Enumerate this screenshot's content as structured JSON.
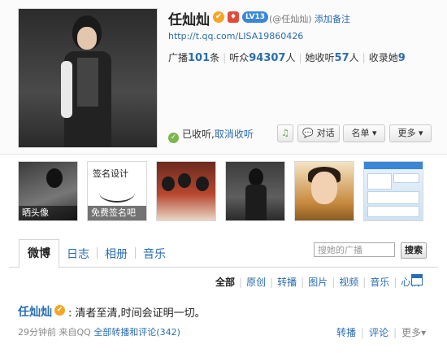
{
  "profile": {
    "name": "任灿灿",
    "v_badge": "✔",
    "r_badge": "♦",
    "level_badge": "LV13",
    "handle": "(@任灿灿)",
    "add_note": "添加备注",
    "url": "http://t.qq.com/LISA19860426",
    "stats": {
      "broadcast_label": "广播",
      "broadcast_value": "101",
      "broadcast_unit": "条",
      "listeners_label": "听众",
      "listeners_value": "94307",
      "listeners_unit": "人",
      "following_label": "她收听",
      "following_value": "57",
      "following_unit": "人",
      "collected_label": "收录她",
      "collected_value": "9"
    },
    "followed_label": "已收听,",
    "unfollow_label": "取消收听",
    "buttons": {
      "dm": "对话",
      "list": "名单",
      "more": "更多"
    }
  },
  "photos": [
    {
      "caption": "晒头像"
    },
    {
      "caption": "免费签名吧",
      "art_text": "签名设计"
    },
    {
      "caption": ""
    },
    {
      "caption": ""
    },
    {
      "caption": ""
    },
    {
      "caption": ""
    }
  ],
  "tabs": [
    "微博",
    "日志",
    "相册",
    "音乐"
  ],
  "search": {
    "placeholder": "搜她的广播",
    "button": "搜索"
  },
  "filters": [
    "全部",
    "原创",
    "转播",
    "图片",
    "视频",
    "音乐",
    "心情"
  ],
  "post": {
    "author": "任灿灿",
    "text": ": 清者至清,时间会证明一切。",
    "time": "29分钟前 来自QQ",
    "repost_comments": "全部转播和评论(342)",
    "actions": {
      "repost": "转播",
      "comment": "评论",
      "more": "更多"
    }
  },
  "colors": {
    "link": "#2a6db0",
    "badge_v": "#f5a623",
    "badge_level": "#3a87d6"
  }
}
